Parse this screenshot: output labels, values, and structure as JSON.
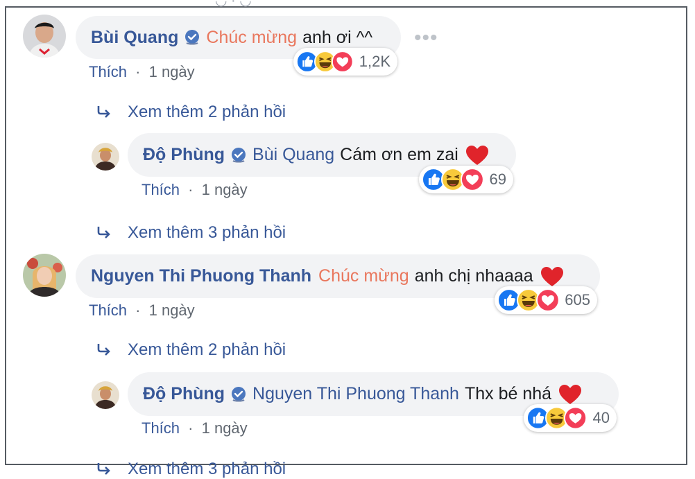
{
  "thread": {
    "comments": [
      {
        "author": "Bùi Quang",
        "tag": "Chúc mừng",
        "text": "anh ơi ^^",
        "reaction_count": "1,2K",
        "like_label": "Thích",
        "time": "1 ngày",
        "more_replies": "Xem thêm 2 phản hồi",
        "reply": {
          "author": "Độ Phùng",
          "mention": "Bùi Quang",
          "text": "Cám ơn em zai",
          "reaction_count": "69",
          "like_label": "Thích",
          "time": "1 ngày"
        },
        "more_replies_after": "Xem thêm 3 phản hồi"
      },
      {
        "author": "Nguyen Thi Phuong Thanh",
        "tag": "Chúc mừng",
        "text": "anh chị nhaaaa",
        "reaction_count": "605",
        "like_label": "Thích",
        "time": "1 ngày",
        "more_replies": "Xem thêm 2 phản hồi",
        "reply": {
          "author": "Độ Phùng",
          "mention": "Nguyen Thi Phuong Thanh",
          "text": "Thx bé nhá",
          "reaction_count": "40",
          "like_label": "Thích",
          "time": "1 ngày"
        },
        "more_replies_after": "Xem thêm 3 phản hồi"
      }
    ],
    "separator": "·"
  },
  "colors": {
    "link": "#385898",
    "tag": "#e9775d",
    "bubble": "#f2f3f5",
    "meta": "#606770"
  },
  "icons": [
    "avatar",
    "verified-badge-icon",
    "like-reaction-icon",
    "haha-reaction-icon",
    "love-reaction-icon",
    "heart-emoji-icon",
    "reply-arrow-icon",
    "more-options-icon"
  ]
}
